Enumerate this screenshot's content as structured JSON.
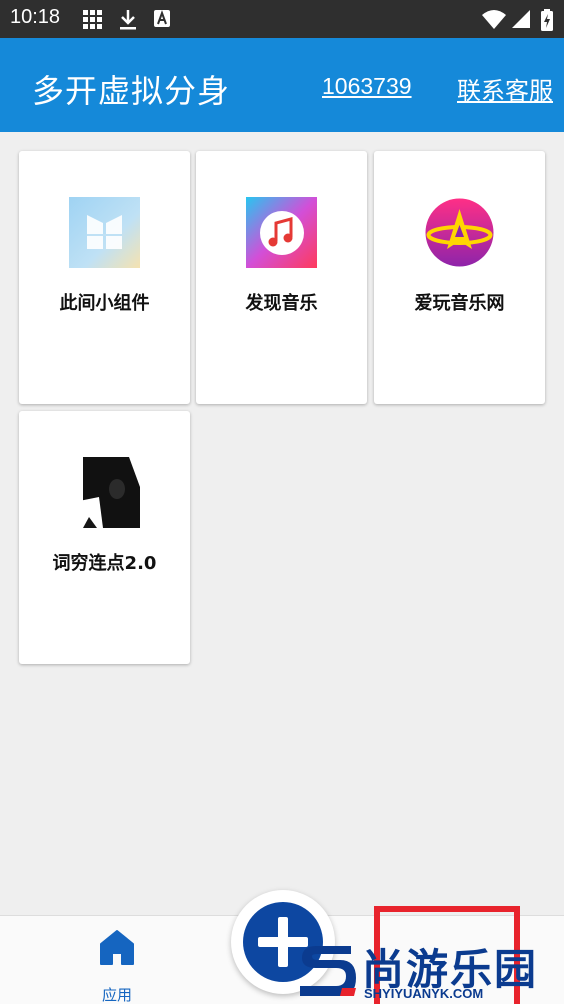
{
  "status_bar": {
    "time": "10:18",
    "left_icons": [
      "grid-icon",
      "download-icon",
      "keyboard-a-icon"
    ],
    "right_icons": [
      "wifi-icon",
      "signal-icon",
      "battery-charging-icon"
    ]
  },
  "header": {
    "title": "多开虚拟分身",
    "id_link": "1063739",
    "service_link": "联系客服",
    "background_color": "#1589d9"
  },
  "apps": [
    {
      "label": "此间小组件",
      "icon": "widget-app-icon"
    },
    {
      "label": "发现音乐",
      "icon": "music-note-app-icon"
    },
    {
      "label": "爱玩音乐网",
      "icon": "star-planet-app-icon"
    },
    {
      "label": "词穷连点2.0",
      "icon": "dark-photo-app-icon"
    }
  ],
  "bottom_nav": {
    "home_label": "应用",
    "accent_color": "#1565c0"
  },
  "watermark": {
    "text": "尚游乐园",
    "url": "SHYIYUANYK.COM"
  }
}
